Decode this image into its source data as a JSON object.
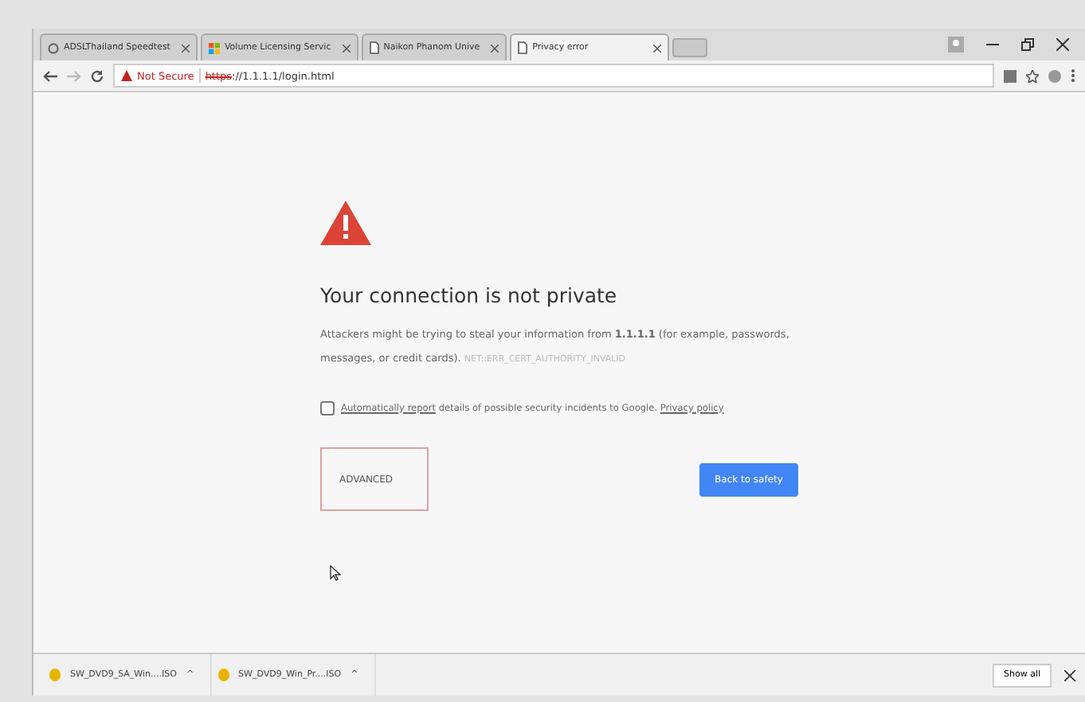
{
  "tabs": [
    {
      "label": "ADSLThailand Speedtest",
      "kind": "speed",
      "selected": false
    },
    {
      "label": "Volume Licensing Servic",
      "kind": "tiles",
      "selected": false
    },
    {
      "label": "Naikon Phanom Unive",
      "kind": "page",
      "selected": false
    },
    {
      "label": "Privacy error",
      "kind": "page",
      "selected": true
    }
  ],
  "address_bar": {
    "security": "Not Secure",
    "scheme": "https",
    "rest": "://1.1.1.1/login.html"
  },
  "error": {
    "title": "Your connection is not private",
    "message": "Attackers might be trying to steal your information from **1.1.1.1** (for example, passwords, messages, or credit cards).",
    "code": "NET::ERR_CERT_AUTHORITY_INVALID",
    "report": {
      "checked": false,
      "link": "Automatically report",
      "text": " details of possible security incidents to Google. ",
      "policy": "Privacy policy"
    },
    "advanced": "ADVANCED",
    "back": "Back to safety"
  },
  "downloads": [
    {
      "name": "SW_DVD9_SA_Win....ISO",
      "caret": "^"
    },
    {
      "name": "SW_DVD9_Win_Pr....ISO",
      "caret": "^"
    }
  ],
  "show_all": "Show all"
}
